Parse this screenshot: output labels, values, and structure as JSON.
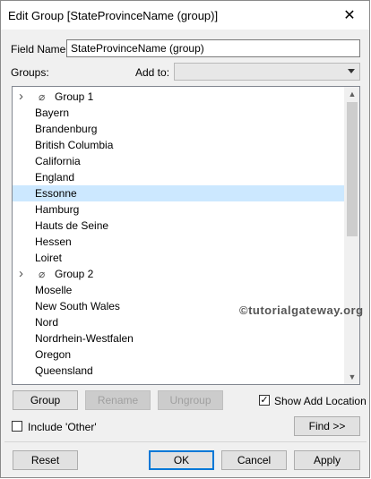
{
  "window": {
    "title": "Edit Group [StateProvinceName (group)]",
    "close_icon": "close-icon"
  },
  "field_name": {
    "label": "Field Name:",
    "value": "StateProvinceName (group)"
  },
  "groups_label": "Groups:",
  "add_to": {
    "label": "Add to:",
    "value": ""
  },
  "tree": {
    "rows": [
      {
        "kind": "group",
        "label": "Group 1"
      },
      {
        "kind": "child",
        "label": "Bayern"
      },
      {
        "kind": "child",
        "label": "Brandenburg"
      },
      {
        "kind": "child",
        "label": "British Columbia"
      },
      {
        "kind": "child",
        "label": "California"
      },
      {
        "kind": "child",
        "label": "England"
      },
      {
        "kind": "child",
        "label": "Essonne",
        "selected": true
      },
      {
        "kind": "child",
        "label": "Hamburg"
      },
      {
        "kind": "child",
        "label": "Hauts de Seine"
      },
      {
        "kind": "child",
        "label": "Hessen"
      },
      {
        "kind": "child",
        "label": "Loiret"
      },
      {
        "kind": "group",
        "label": "Group 2"
      },
      {
        "kind": "child",
        "label": "Moselle"
      },
      {
        "kind": "child",
        "label": "New South Wales"
      },
      {
        "kind": "child",
        "label": "Nord"
      },
      {
        "kind": "child",
        "label": "Nordrhein-Westfalen"
      },
      {
        "kind": "child",
        "label": "Oregon"
      },
      {
        "kind": "child",
        "label": "Queensland"
      }
    ]
  },
  "watermark": "©tutorialgateway.org",
  "actions": {
    "group": "Group",
    "rename": "Rename",
    "ungroup": "Ungroup",
    "show_add_location": {
      "label": "Show Add Location",
      "checked": true
    },
    "include_other": {
      "label": "Include 'Other'",
      "checked": false
    },
    "find": "Find >>"
  },
  "footer": {
    "reset": "Reset",
    "ok": "OK",
    "cancel": "Cancel",
    "apply": "Apply"
  },
  "colors": {
    "selected_row": "#cce8ff",
    "default_button_border": "#0078d7"
  }
}
